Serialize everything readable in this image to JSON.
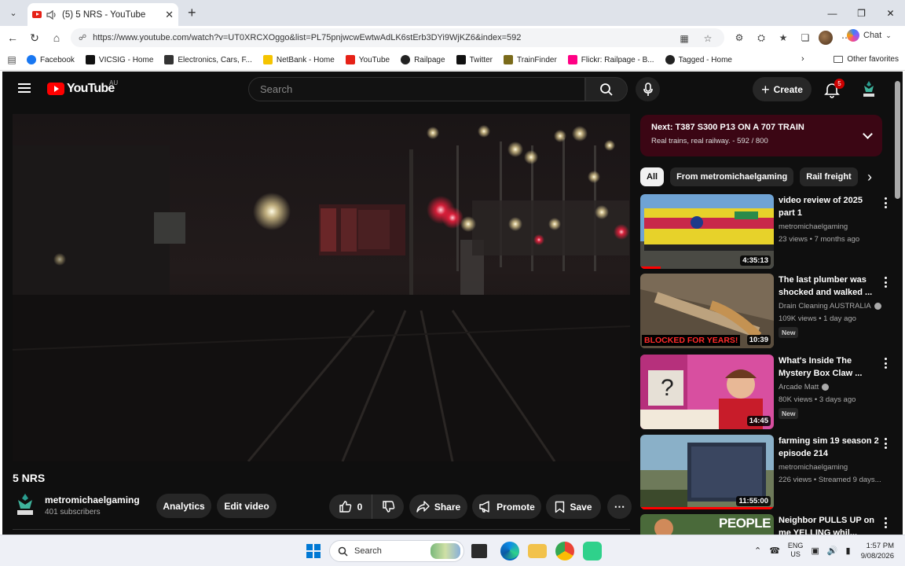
{
  "browser": {
    "tab_title": "(5) 5 NRS - YouTube",
    "url": "https://www.youtube.com/watch?v=UT0XRCXOggo&list=PL75pnjwcwEwtwAdLK6stErb3DYi9WjKZ6&index=592",
    "chat_label": "Chat",
    "bookmarks": [
      {
        "label": "Facebook",
        "icon": "facebook-icon",
        "color": "#1877f2"
      },
      {
        "label": "VICSIG - Home",
        "icon": "vicsig-icon",
        "color": "#111111"
      },
      {
        "label": "Electronics, Cars, F...",
        "icon": "ebay-icon",
        "color": "#333333"
      },
      {
        "label": "NetBank - Home",
        "icon": "netbank-icon",
        "color": "#f5c400"
      },
      {
        "label": "YouTube",
        "icon": "youtube-icon",
        "color": "#e62117"
      },
      {
        "label": "Railpage",
        "icon": "railpage-icon",
        "color": "#222222"
      },
      {
        "label": "Twitter",
        "icon": "x-icon",
        "color": "#111111"
      },
      {
        "label": "TrainFinder",
        "icon": "trainfinder-icon",
        "color": "#7a6a1a"
      },
      {
        "label": "Flickr: Railpage - B...",
        "icon": "flickr-icon",
        "color": "#ff0084"
      },
      {
        "label": "Tagged - Home",
        "icon": "tagged-icon",
        "color": "#222222"
      }
    ],
    "other_favorites": "Other favorites"
  },
  "youtube": {
    "country": "AU",
    "search_placeholder": "Search",
    "create_label": "Create",
    "notifications_count": "5",
    "video_title": "5 NRS",
    "channel_name": "metromichaelgaming",
    "subscribers": "401 subscribers",
    "analytics_label": "Analytics",
    "edit_video_label": "Edit video",
    "likes": "0",
    "share_label": "Share",
    "promote_label": "Promote",
    "save_label": "Save",
    "next_title": "Next: T387 S300 P13 ON A 707 TRAIN",
    "next_subtitle": "Real trains, real railway. - 592 / 800",
    "chips": [
      "All",
      "From metromichaelgaming",
      "Rail freight"
    ],
    "recommendations": [
      {
        "title": "video review of 2025 part 1",
        "channel": "metromichaelgaming",
        "verified": false,
        "meta": "23 views • 7 months ago",
        "duration": "4:35:13",
        "new": false,
        "watched": 0.15
      },
      {
        "title": "The last plumber was shocked and walked ...",
        "channel": "Drain Cleaning AUSTRALIA",
        "verified": true,
        "meta": "109K views • 1 day ago",
        "duration": "10:39",
        "new": true,
        "overlay_text": "BLOCKED FOR YEARS!"
      },
      {
        "title": "What's Inside The Mystery Box Claw ...",
        "channel": "Arcade Matt",
        "verified": true,
        "meta": "80K views • 3 days ago",
        "duration": "14:45",
        "new": true
      },
      {
        "title": "farming sim 19 season 2 episode 214",
        "channel": "metromichaelgaming",
        "verified": false,
        "meta": "226 views • Streamed 9 days...",
        "duration": "11:55:00",
        "new": false,
        "watched": 1.0
      },
      {
        "title": "Neighbor PULLS UP on me YELLING whil...",
        "channel": "",
        "verified": false,
        "meta": "",
        "duration": "",
        "new": false,
        "overlay_text": "PEOPLE"
      }
    ],
    "new_label": "New"
  },
  "taskbar": {
    "search_label": "Search",
    "lang_top": "ENG",
    "lang_bottom": "US",
    "time": "1:57 PM",
    "date": "9/08/2026"
  }
}
